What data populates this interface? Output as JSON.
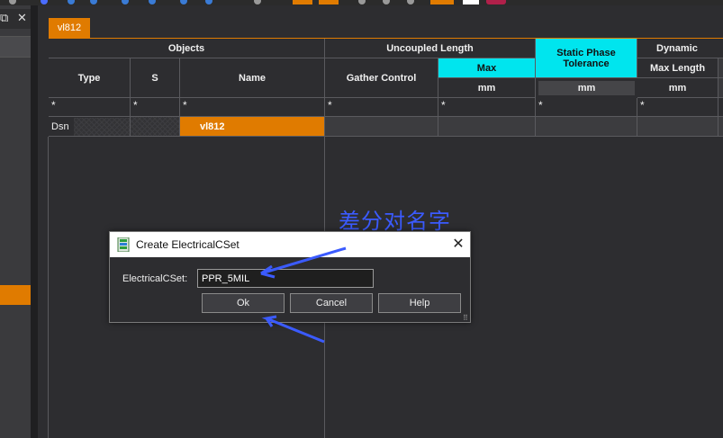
{
  "window": {
    "restore_glyph": "⧉",
    "close_glyph": "✕"
  },
  "tab": {
    "label": "vl812"
  },
  "grid": {
    "groups": {
      "objects": "Objects",
      "uncoupled_length": "Uncoupled Length",
      "static_phase_tolerance": "Static Phase Tolerance",
      "dynamic": "Dynamic"
    },
    "columns": {
      "type": "Type",
      "s": "S",
      "name": "Name",
      "gather_control": "Gather Control",
      "max": "Max",
      "max_length": "Max Length"
    },
    "units": {
      "max": "mm",
      "static_phase": "mm",
      "max_length": "mm"
    },
    "filter": "*",
    "rows": [
      {
        "type": "Dsn",
        "name": "vl812"
      }
    ]
  },
  "annotation": {
    "text": "差分对名字"
  },
  "dialog": {
    "title": "Create ElectricalCSet",
    "close_glyph": "✕",
    "field_label": "ElectricalCSet:",
    "field_value": "PPR_5MIL",
    "buttons": {
      "ok": "Ok",
      "cancel": "Cancel",
      "help": "Help"
    },
    "grip_glyph": "⠿"
  },
  "colors": {
    "accent": "#e07b00",
    "highlight": "#00e5ee",
    "annotation": "#3b5bff"
  }
}
